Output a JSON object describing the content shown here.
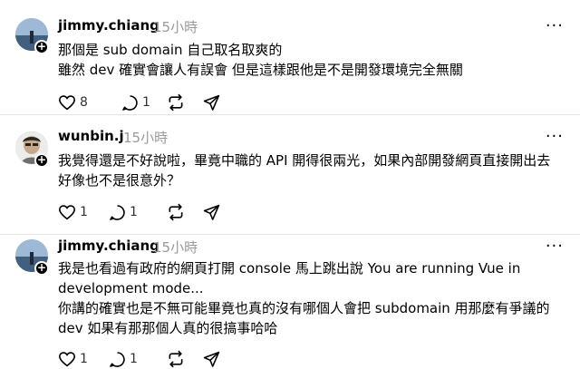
{
  "posts": [
    {
      "username": "jimmy.chiang",
      "time": "15小時",
      "lines": [
        "那個是 sub domain 自己取名取爽的",
        "雖然 dev 確實會讓人有誤會 但是這樣跟他是不是開發環境完全無關"
      ],
      "likes": "8",
      "replies": "1",
      "reposts": "",
      "avatar": "landscape-avatar"
    },
    {
      "username": "wunbin.j",
      "time": "15小時",
      "lines": [
        "我覺得還是不好說啦，畢竟中職的 API 開得很兩光，如果內部開發網頁直接開出去",
        "好像也不是很意外？"
      ],
      "likes": "1",
      "replies": "1",
      "reposts": "",
      "avatar": "person-avatar"
    },
    {
      "username": "jimmy.chiang",
      "time": "15小時",
      "lines": [
        "我是也看過有政府的網頁打開 console 馬上跳出說 You are running Vue in",
        "development mode...",
        "你講的確實也是不無可能畢竟也真的沒有哪個人會把 subdomain 用那麼有爭議的",
        "dev 如果有那那個人真的很搞事哈哈"
      ],
      "likes": "1",
      "replies": "1",
      "reposts": "",
      "avatar": "landscape-avatar"
    }
  ],
  "more_label": "···",
  "plus_label": "+",
  "icons": [
    "heart-icon",
    "comment-icon",
    "repost-icon",
    "share-icon"
  ],
  "colors": {
    "text": "#000000",
    "muted": "#999999",
    "divider": "#e5e5e5"
  }
}
